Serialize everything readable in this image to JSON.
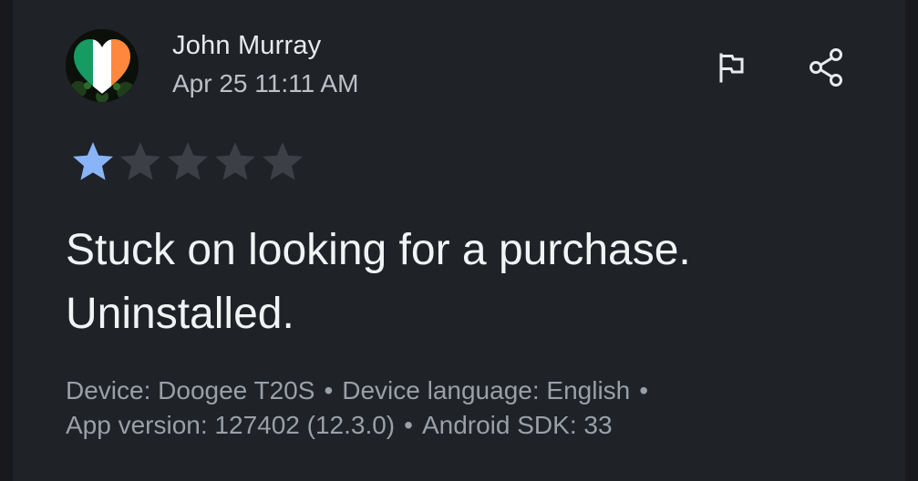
{
  "review": {
    "author": "John Murray",
    "date": "Apr 25 11:11 AM",
    "avatar_icon": "ireland-flag-heart-avatar",
    "rating": 1,
    "rating_max": 5,
    "text_line1": "Stuck on looking for a purchase.",
    "text_line2": "Uninstalled.",
    "device": "Device: Doogee T20S",
    "device_language": "Device language: English",
    "app_version": "App version: 127402 (12.3.0)",
    "android_sdk": "Android SDK: 33",
    "separator": "•"
  },
  "actions": {
    "flag_icon": "flag-icon",
    "share_icon": "share-icon"
  },
  "colors": {
    "background": "#1f2227",
    "star_filled": "#8ab4f8",
    "star_empty": "#3c4046",
    "text_primary": "#f1f3f4",
    "text_secondary": "#9aa0a6"
  }
}
